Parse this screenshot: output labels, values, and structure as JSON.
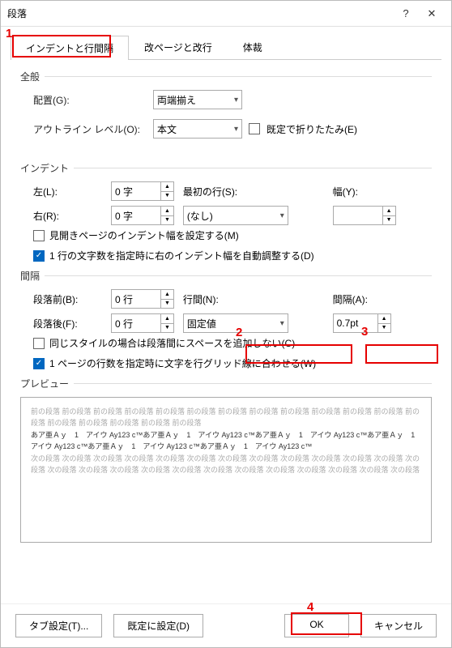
{
  "title": "段落",
  "markers": {
    "m1": "1",
    "m2": "2",
    "m3": "3",
    "m4": "4"
  },
  "tabs": {
    "indent": "インデントと行間隔",
    "page": "改ページと改行",
    "style": "体裁"
  },
  "general": {
    "heading": "全般",
    "alignment_label": "配置(G):",
    "alignment_value": "両端揃え",
    "outline_label": "アウトライン レベル(O):",
    "outline_value": "本文",
    "collapse_label": "既定で折りたたみ(E)"
  },
  "indent": {
    "heading": "インデント",
    "left_label": "左(L):",
    "left_value": "0 字",
    "right_label": "右(R):",
    "right_value": "0 字",
    "first_label": "最初の行(S):",
    "first_value": "(なし)",
    "width_label": "幅(Y):",
    "width_value": "",
    "mirror_label": "見開きページのインデント幅を設定する(M)",
    "autoadj_label": "1 行の文字数を指定時に右のインデント幅を自動調整する(D)"
  },
  "spacing": {
    "heading": "間隔",
    "before_label": "段落前(B):",
    "before_value": "0 行",
    "after_label": "段落後(F):",
    "after_value": "0 行",
    "line_label": "行間(N):",
    "line_value": "固定値",
    "at_label": "間隔(A):",
    "at_value": "0.7pt",
    "nospace_label": "同じスタイルの場合は段落間にスペースを追加しない(C)",
    "grid_label": "1 ページの行数を指定時に文字を行グリッド線に合わせる(W)"
  },
  "preview": {
    "heading": "プレビュー",
    "before_text": "前の段落 前の段落 前の段落 前の段落 前の段落 前の段落 前の段落 前の段落 前の段落 前の段落 前の段落 前の段落 前の段落 前の段落 前の段落 前の段落 前の段落 前の段落",
    "sample_text": "あア亜Ａｙ　1　アイウ Ay123 c™あア亜Ａｙ　1　アイウ Ay123 c™あア亜Ａｙ　1　アイウ Ay123 c™あア亜Ａｙ　1　アイウ Ay123 c™あア亜Ａｙ　1　アイウ Ay123 c™あア亜Ａｙ　1　アイウ Ay123 c™",
    "after_text": "次の段落 次の段落 次の段落 次の段落 次の段落 次の段落 次の段落 次の段落 次の段落 次の段落 次の段落 次の段落 次の段落 次の段落 次の段落 次の段落 次の段落 次の段落 次の段落 次の段落 次の段落 次の段落 次の段落 次の段落 次の段落"
  },
  "buttons": {
    "tabs": "タブ設定(T)...",
    "default": "既定に設定(D)",
    "ok": "OK",
    "cancel": "キャンセル"
  }
}
